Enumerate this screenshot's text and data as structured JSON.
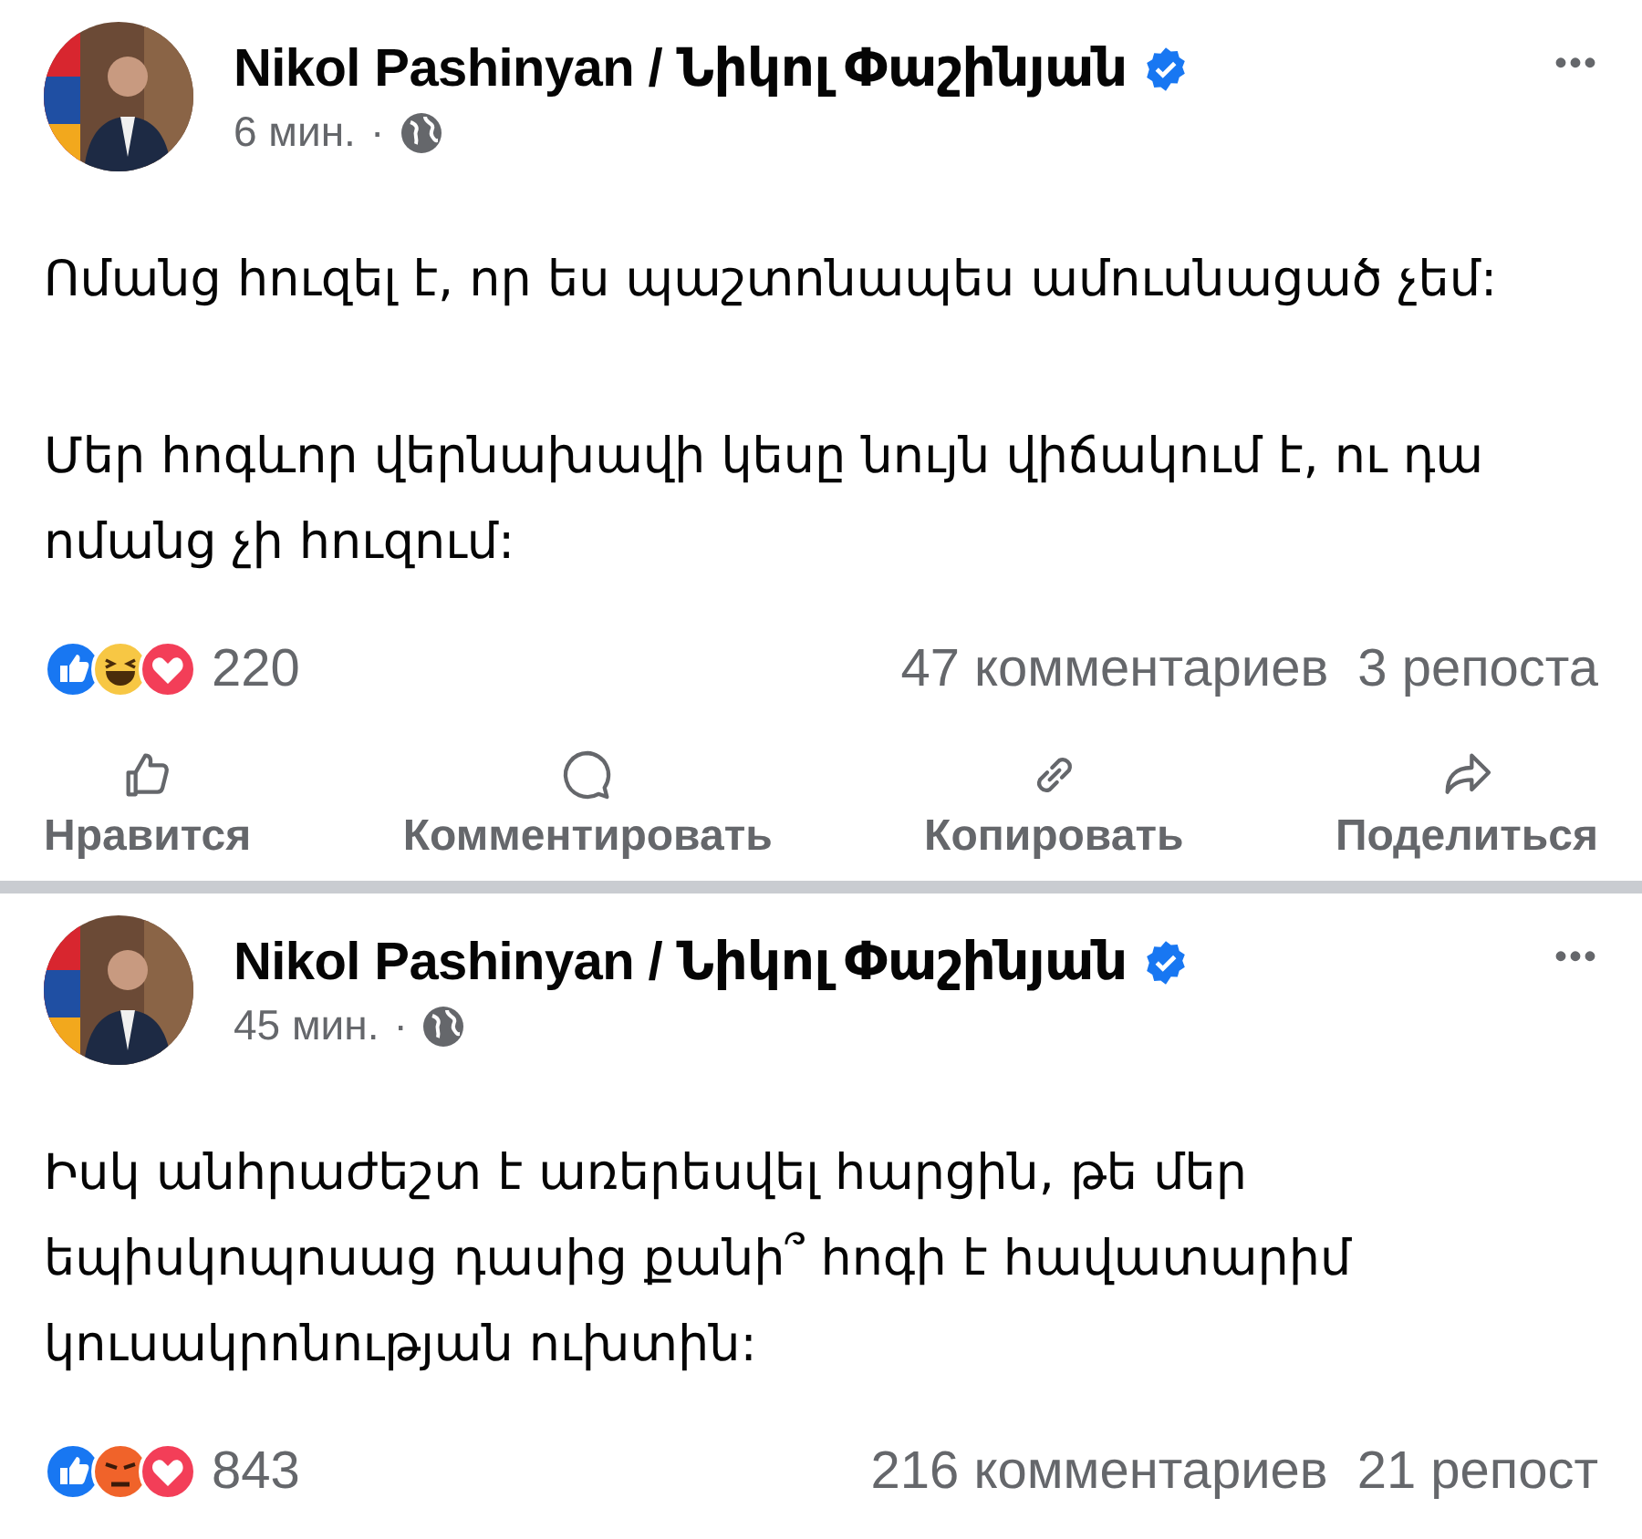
{
  "posts": [
    {
      "author": "Nikol Pashinyan / Նիկոլ Փաշինյան",
      "verified": true,
      "time": "6 мин.",
      "separator": "·",
      "more": "•••",
      "avatar": {
        "kind": "picture"
      },
      "paragraphs": [
        "Ոմանց հուզել է, որ ես պաշտոնապես ամուսնացած չեմ:",
        "Մեր հոգևոր վերնախավի կեսը նույն վիճակում է, ու դա ոմանց չի հուզում:"
      ],
      "reactions": [
        {
          "kind": "like"
        },
        {
          "kind": "haha"
        },
        {
          "kind": "love"
        }
      ],
      "reaction_count": "220",
      "comments": "47 комментариев",
      "shares": "3 репоста",
      "actions": [
        {
          "kind": "like",
          "label": "Нравится"
        },
        {
          "kind": "comment",
          "label": "Комментировать"
        },
        {
          "kind": "copy",
          "label": "Копировать"
        },
        {
          "kind": "share",
          "label": "Поделиться"
        }
      ]
    },
    {
      "author": "Nikol Pashinyan / Նիկոլ Փաշինյան",
      "verified": true,
      "time": "45 мин.",
      "separator": "·",
      "more": "•••",
      "avatar": {
        "kind": "picture"
      },
      "paragraphs": [
        "Իսկ անհրաժեշտ է առերեսվել հարցին, թե մեր եպիսկոպոսաց դասից քանի՞ հոգի է հավատարիմ կուսակրոնության ուխտին:"
      ],
      "reactions": [
        {
          "kind": "like"
        },
        {
          "kind": "angry"
        },
        {
          "kind": "love"
        }
      ],
      "reaction_count": "843",
      "comments": "216 комментариев",
      "shares": "21 репост"
    }
  ]
}
